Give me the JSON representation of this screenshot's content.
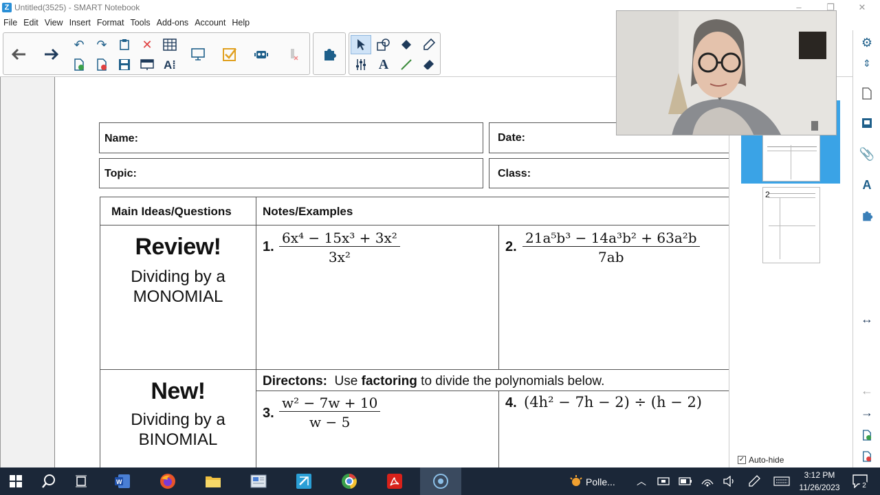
{
  "window": {
    "title": "Untitled(3525) - SMART Notebook",
    "app_icon": "notebook-icon",
    "controls": [
      "minimize-icon",
      "restore-icon",
      "close-icon"
    ]
  },
  "menu": [
    "File",
    "Edit",
    "View",
    "Insert",
    "Format",
    "Tools",
    "Add-ons",
    "Account",
    "Help"
  ],
  "toolbar": {
    "icons": [
      "back-arrow-icon",
      "forward-arrow-icon",
      "undo-icon",
      "redo-icon",
      "paste-icon",
      "delete-icon",
      "table-icon",
      "add-page-icon",
      "delete-page-icon",
      "save-icon",
      "screen-shade-icon",
      "text-recognition-icon",
      "display-icon",
      "activity-builder-icon",
      "lab-icon",
      "clear-ink-icon",
      "addon-puzzle-icon",
      "select-icon",
      "shapes-icon",
      "fill-icon",
      "pen-icon",
      "properties-icon",
      "text-icon",
      "line-icon",
      "eraser-icon"
    ]
  },
  "worksheet": {
    "name_label": "Name:",
    "date_label": "Date:",
    "topic_label": "Topic:",
    "class_label": "Class:",
    "col_main": "Main Ideas/Questions",
    "col_notes": "Notes/Examples",
    "review_title": "Review!",
    "review_sub1": "Dividing by a",
    "review_sub2": "MONOMIAL",
    "new_title": "New!",
    "new_sub1": "Dividing by a",
    "new_sub2": "BINOMIAL",
    "directions_label": "Directons:",
    "directions_pre": "Use",
    "directions_bold": "factoring",
    "directions_post": "to divide the polynomials below.",
    "problems": [
      {
        "num": "1.",
        "numerator": "6x⁴ − 15x³ + 3x²",
        "denominator": "3x²"
      },
      {
        "num": "2.",
        "numerator": "21a⁵b³ − 14a³b² + 63a²b",
        "denominator": "7ab"
      },
      {
        "num": "3.",
        "numerator": "w² − 7w + 10",
        "denominator": "w − 5"
      },
      {
        "num": "4.",
        "expression": "(4h² − 7h − 2) ÷ (h − 2)"
      }
    ]
  },
  "pages_panel": {
    "page2_number": "2",
    "auto_hide_label": "Auto-hide",
    "auto_hide_checked": true
  },
  "right_sidebar": {
    "icons": [
      "settings-gear-icon",
      "move-toolbar-icon",
      "page-sorter-icon",
      "gallery-icon",
      "attachments-icon",
      "properties-icon",
      "addons-icon",
      "resize-arrows-icon",
      "prev-page-icon",
      "next-page-icon",
      "add-page-icon",
      "delete-page-icon"
    ]
  },
  "taskbar": {
    "apps": [
      "windows-start-icon",
      "search-icon",
      "task-view-icon",
      "word-icon",
      "firefox-icon",
      "file-explorer-icon",
      "app-icon",
      "smart-notebook-icon",
      "chrome-icon",
      "acrobat-icon",
      "recorder-icon"
    ],
    "weather_label": "Polle...",
    "time": "3:12 PM",
    "date": "11/26/2023",
    "notification_count": "2"
  },
  "colors": {
    "accent": "#3aa3e6",
    "taskbar": "#1b2738",
    "toolbar_blue": "#1e5f8a"
  }
}
